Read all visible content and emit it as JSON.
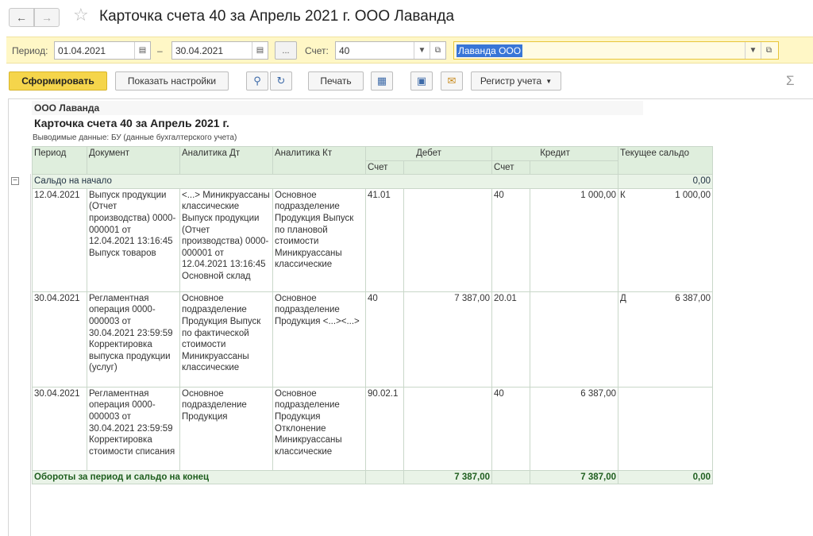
{
  "window": {
    "title": "Карточка счета 40 за Апрель 2021 г. ООО Лаванда"
  },
  "params": {
    "period_label": "Период:",
    "date_from": "01.04.2021",
    "dash": "–",
    "date_to": "30.04.2021",
    "dots_button": "...",
    "account_label": "Счет:",
    "account_value": "40",
    "organization": "Лаванда ООО"
  },
  "toolbar": {
    "generate": "Сформировать",
    "show_settings": "Показать настройки",
    "print": "Печать",
    "register": "Регистр учета",
    "sigma": "Σ"
  },
  "report": {
    "org": "ООО Лаванда",
    "title": "Карточка счета 40 за Апрель 2021 г.",
    "params_line": "Выводимые данные:  БУ (данные бухгалтерского учета)",
    "columns": {
      "period": "Период",
      "document": "Документ",
      "analytics_dt": "Аналитика Дт",
      "analytics_kt": "Аналитика Кт",
      "debit": "Дебет",
      "credit": "Кредит",
      "balance": "Текущее сальдо",
      "account": "Счет"
    },
    "opening": {
      "label": "Сальдо на начало",
      "value": "0,00"
    },
    "rows": [
      {
        "date": "12.04.2021",
        "document": "Выпуск продукции (Отчет производства) 0000-000001 от 12.04.2021 13:16:45 Выпуск товаров",
        "analytics_dt": "<...> Миникруассаны классические Выпуск продукции (Отчет производства) 0000-000001 от 12.04.2021 13:16:45 Основной склад",
        "analytics_kt": "Основное подразделение Продукция Выпуск по плановой стоимости Миникруассаны классические",
        "dt_account": "41.01",
        "dt_sum": "",
        "kt_account": "40",
        "kt_sum": "1 000,00",
        "bal_type": "К",
        "bal_sum": "1 000,00"
      },
      {
        "date": "30.04.2021",
        "document": "Регламентная операция 0000-000003 от 30.04.2021 23:59:59 Корректировка выпуска продукции (услуг)",
        "analytics_dt": "Основное подразделение Продукция Выпуск по фактической стоимости Миникруассаны классические",
        "analytics_kt": "Основное подразделение Продукция <...><...>",
        "dt_account": "40",
        "dt_sum": "7 387,00",
        "kt_account": "20.01",
        "kt_sum": "",
        "bal_type": "Д",
        "bal_sum": "6 387,00"
      },
      {
        "date": "30.04.2021",
        "document": "Регламентная операция 0000-000003 от 30.04.2021 23:59:59 Корректировка стоимости списания",
        "analytics_dt": "Основное подразделение Продукция",
        "analytics_kt": "Основное подразделение Продукция Отклонение Миникруассаны классические",
        "dt_account": "90.02.1",
        "dt_sum": "",
        "kt_account": "40",
        "kt_sum": "6 387,00",
        "bal_type": "",
        "bal_sum": ""
      }
    ],
    "totals": {
      "label": "Обороты за период и сальдо на конец",
      "debit": "7 387,00",
      "credit": "7 387,00",
      "balance": "0,00"
    }
  }
}
